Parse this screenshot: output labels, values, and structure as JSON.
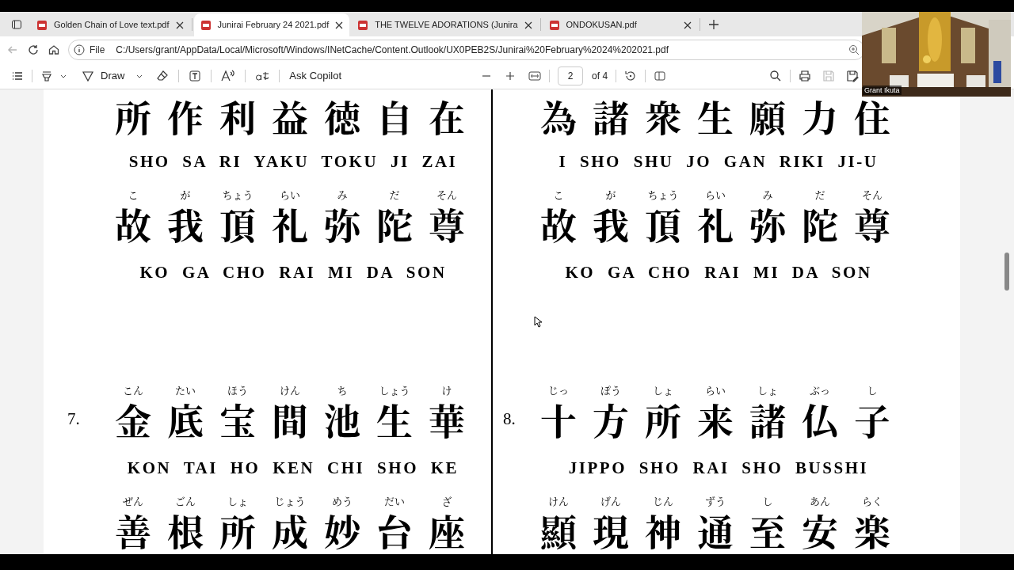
{
  "tabs": [
    {
      "title": "Golden Chain of Love text.pdf",
      "selected": false
    },
    {
      "title": "Junirai February 24 2021.pdf",
      "selected": true
    },
    {
      "title": "THE TWELVE ADORATIONS (Junira",
      "selected": false
    },
    {
      "title": "ONDOKUSAN.pdf",
      "selected": false
    }
  ],
  "address": {
    "label": "File",
    "url": "C:/Users/grant/AppData/Local/Microsoft/Windows/INetCache/Content.Outlook/UX0PEB2S/Junirai%20February%2024%202021.pdf"
  },
  "toolbar": {
    "draw_label": "Draw",
    "copilot_label": "Ask Copilot",
    "page": "2",
    "page_total": "of 4"
  },
  "video": {
    "name": "Grant Ikuta"
  },
  "columns": [
    {
      "verses": [
        {
          "lines": [
            {
              "kind": "kanji",
              "chars": [
                {
                  "char": "所"
                },
                {
                  "char": "作"
                },
                {
                  "char": "利"
                },
                {
                  "char": "益"
                },
                {
                  "char": "徳"
                },
                {
                  "char": "自"
                },
                {
                  "char": "在"
                }
              ]
            },
            {
              "kind": "romaji",
              "text": "SHO SA RI YAKU TOKU JI ZAI"
            },
            {
              "kind": "kanji",
              "chars": [
                {
                  "char": "故",
                  "ruby": "こ"
                },
                {
                  "char": "我",
                  "ruby": "が"
                },
                {
                  "char": "頂",
                  "ruby": "ちょう"
                },
                {
                  "char": "礼",
                  "ruby": "らい"
                },
                {
                  "char": "弥",
                  "ruby": "み"
                },
                {
                  "char": "陀",
                  "ruby": "だ"
                },
                {
                  "char": "尊",
                  "ruby": "そん"
                }
              ]
            },
            {
              "kind": "romaji",
              "text": "KO GA CHO RAI MI DA SON"
            }
          ]
        },
        {
          "number": "7.",
          "lines": [
            {
              "kind": "kanji",
              "chars": [
                {
                  "char": "金",
                  "ruby": "こん"
                },
                {
                  "char": "底",
                  "ruby": "たい"
                },
                {
                  "char": "宝",
                  "ruby": "ほう"
                },
                {
                  "char": "間",
                  "ruby": "けん"
                },
                {
                  "char": "池",
                  "ruby": "ち"
                },
                {
                  "char": "生",
                  "ruby": "しょう"
                },
                {
                  "char": "華",
                  "ruby": "け"
                }
              ]
            },
            {
              "kind": "romaji",
              "text": "KON TAI HO KEN CHI SHO KE"
            },
            {
              "kind": "kanji",
              "chars": [
                {
                  "char": "善",
                  "ruby": "ぜん"
                },
                {
                  "char": "根",
                  "ruby": "ごん"
                },
                {
                  "char": "所",
                  "ruby": "しょ"
                },
                {
                  "char": "成",
                  "ruby": "じょう"
                },
                {
                  "char": "妙",
                  "ruby": "めう"
                },
                {
                  "char": "台",
                  "ruby": "だい"
                },
                {
                  "char": "座",
                  "ruby": "ざ"
                }
              ]
            }
          ]
        }
      ]
    },
    {
      "verses": [
        {
          "lines": [
            {
              "kind": "kanji",
              "chars": [
                {
                  "char": "為"
                },
                {
                  "char": "諸"
                },
                {
                  "char": "衆"
                },
                {
                  "char": "生"
                },
                {
                  "char": "願"
                },
                {
                  "char": "力"
                },
                {
                  "char": "住"
                }
              ]
            },
            {
              "kind": "romaji",
              "text": "I SHO SHU JO GAN RIKI JI-U"
            },
            {
              "kind": "kanji",
              "chars": [
                {
                  "char": "故",
                  "ruby": "こ"
                },
                {
                  "char": "我",
                  "ruby": "が"
                },
                {
                  "char": "頂",
                  "ruby": "ちょう"
                },
                {
                  "char": "礼",
                  "ruby": "らい"
                },
                {
                  "char": "弥",
                  "ruby": "み"
                },
                {
                  "char": "陀",
                  "ruby": "だ"
                },
                {
                  "char": "尊",
                  "ruby": "そん"
                }
              ]
            },
            {
              "kind": "romaji",
              "text": "KO GA CHO RAI MI DA SON"
            }
          ]
        },
        {
          "number": "8.",
          "lines": [
            {
              "kind": "kanji",
              "chars": [
                {
                  "char": "十",
                  "ruby": "じっ"
                },
                {
                  "char": "方",
                  "ruby": "ぽう"
                },
                {
                  "char": "所",
                  "ruby": "しょ"
                },
                {
                  "char": "来",
                  "ruby": "らい"
                },
                {
                  "char": "諸",
                  "ruby": "しょ"
                },
                {
                  "char": "仏",
                  "ruby": "ぶっ"
                },
                {
                  "char": "子",
                  "ruby": "し"
                }
              ]
            },
            {
              "kind": "romaji",
              "text": "JIPPO SHO RAI SHO BUSSHI"
            },
            {
              "kind": "kanji",
              "chars": [
                {
                  "char": "顯",
                  "ruby": "けん"
                },
                {
                  "char": "現",
                  "ruby": "げん"
                },
                {
                  "char": "神",
                  "ruby": "じん"
                },
                {
                  "char": "通",
                  "ruby": "ずう"
                },
                {
                  "char": "至",
                  "ruby": "し"
                },
                {
                  "char": "安",
                  "ruby": "あん"
                },
                {
                  "char": "楽",
                  "ruby": "らく"
                }
              ]
            }
          ]
        }
      ]
    }
  ]
}
